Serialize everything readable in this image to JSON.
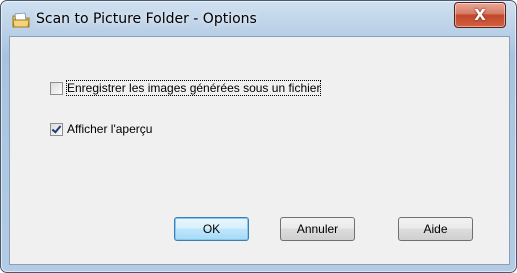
{
  "window": {
    "title": "Scan to Picture Folder - Options",
    "close_label": "X"
  },
  "options": [
    {
      "label": "Enregistrer les images générées sous un fichier",
      "checked": false
    },
    {
      "label": "Afficher l'aperçu",
      "checked": true
    }
  ],
  "buttons": {
    "ok": "OK",
    "cancel": "Annuler",
    "help": "Aide"
  }
}
